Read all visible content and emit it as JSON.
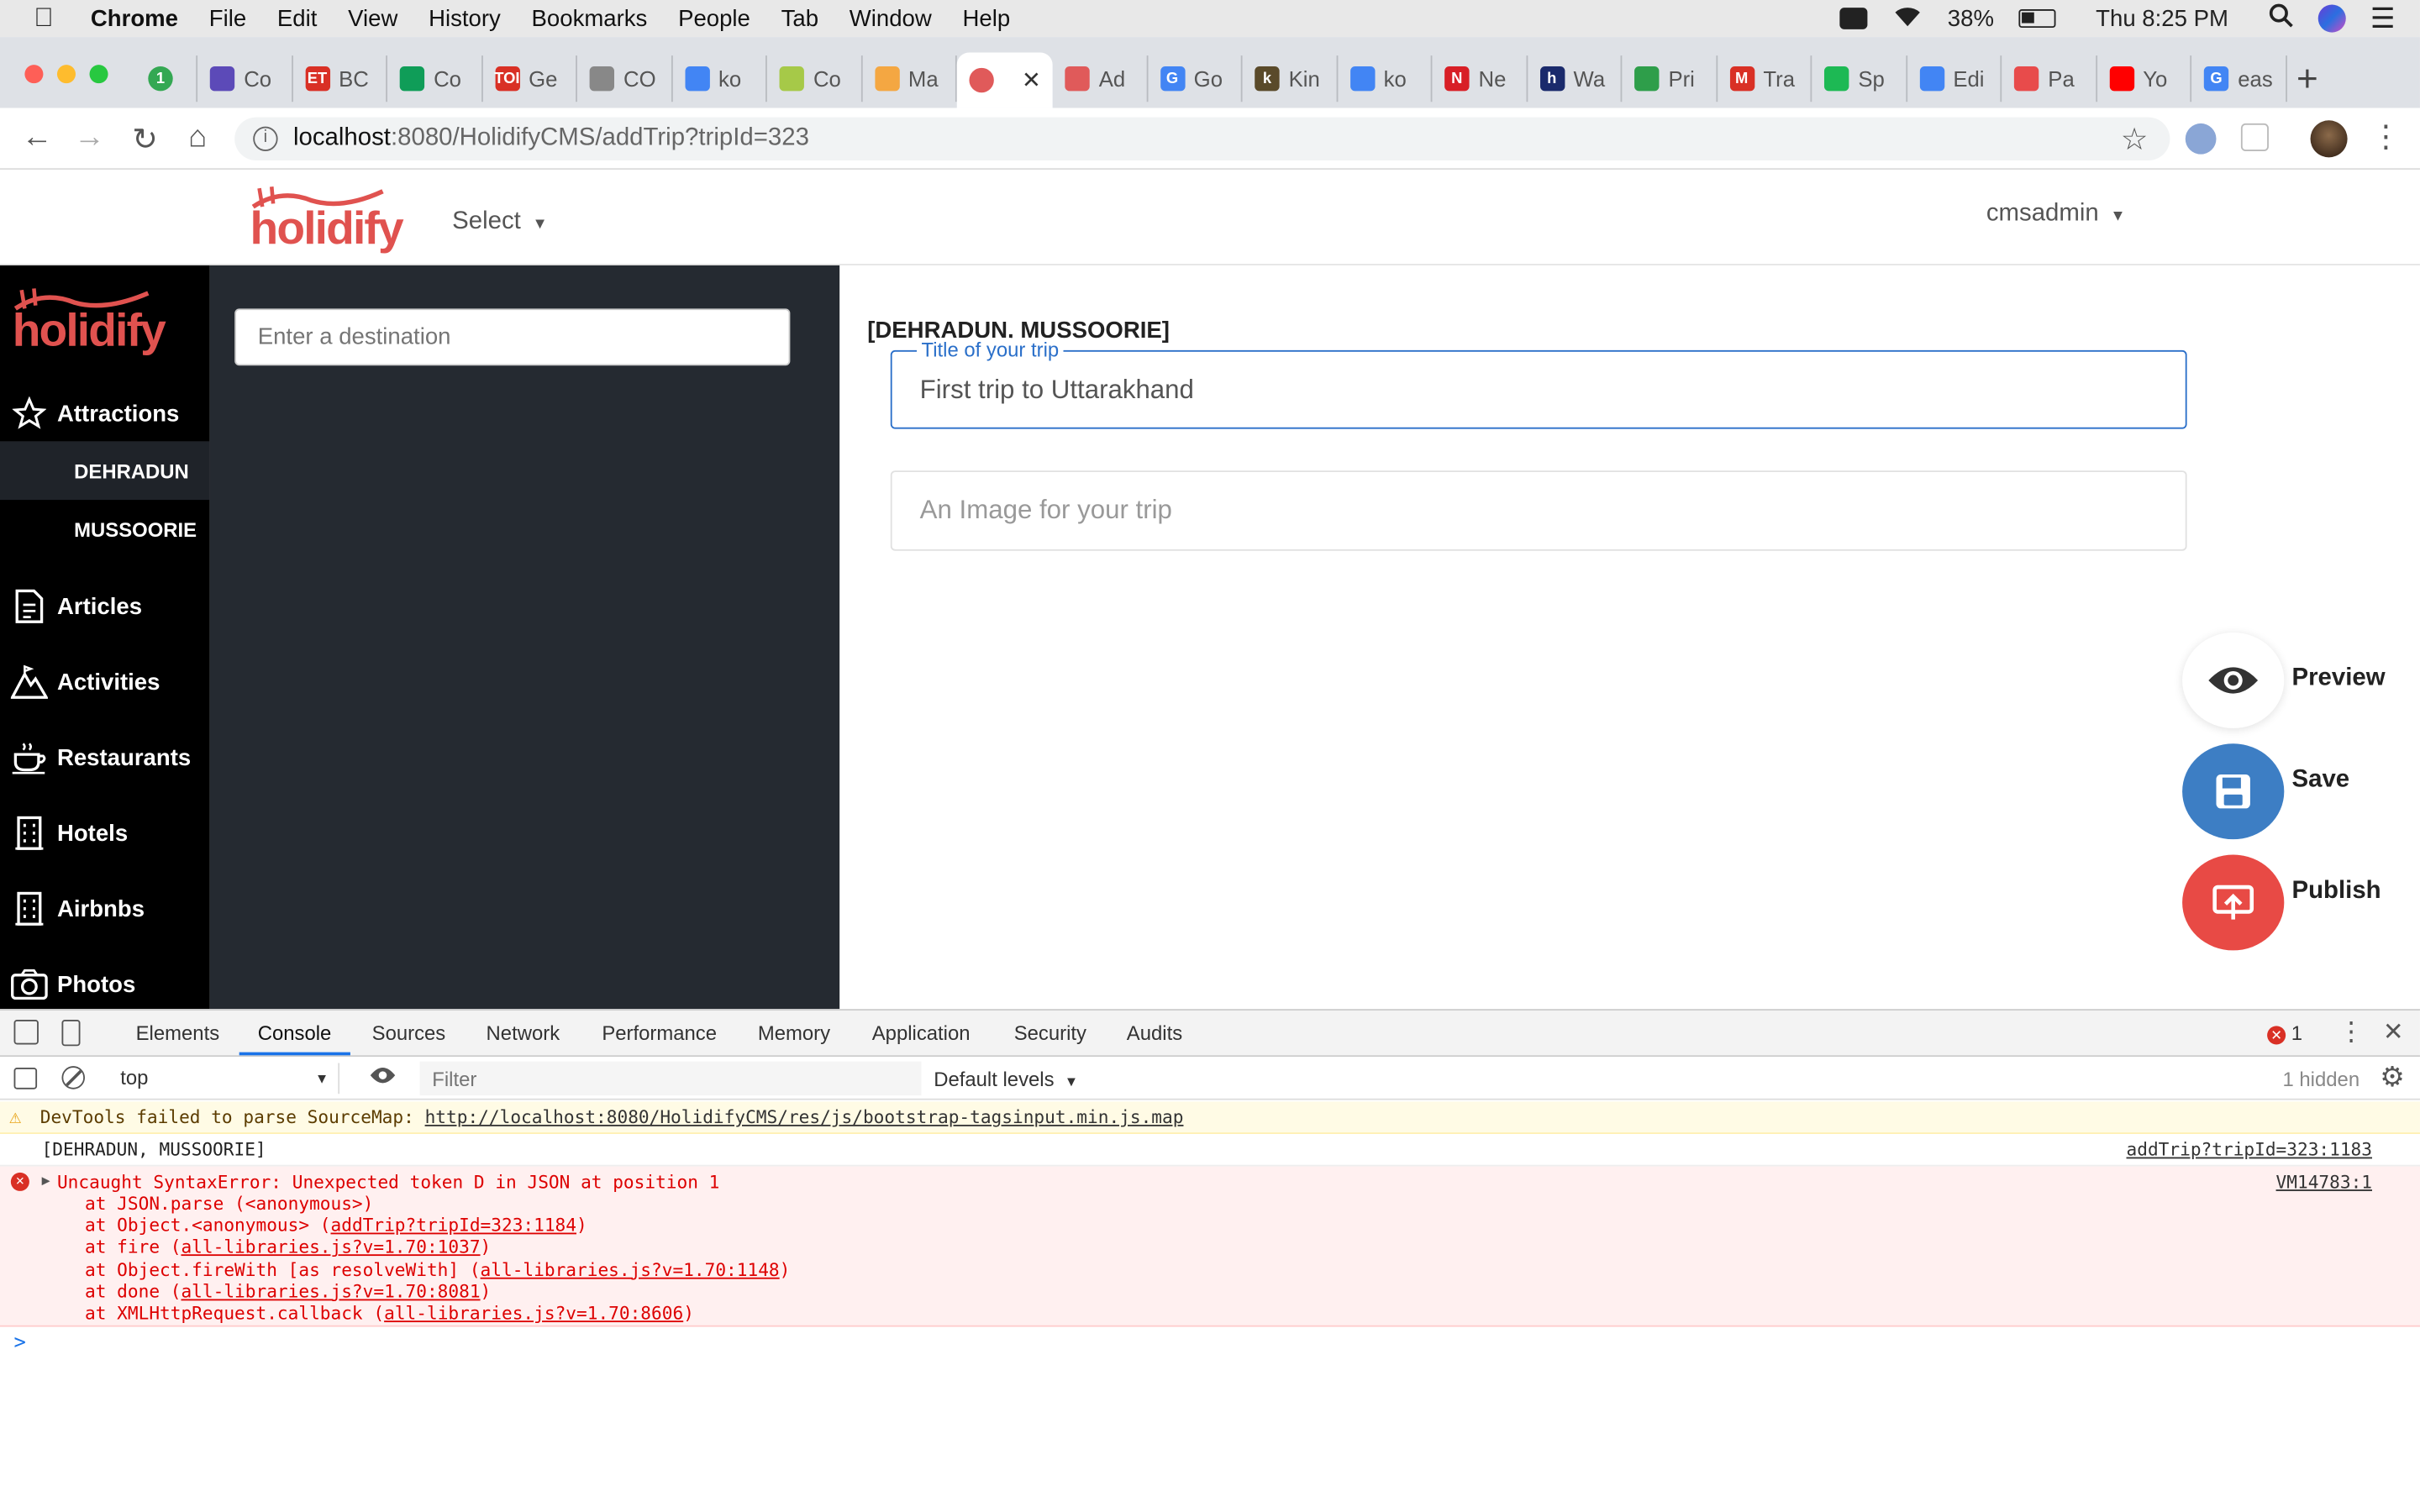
{
  "menubar": {
    "app": "Chrome",
    "items": [
      "File",
      "Edit",
      "View",
      "History",
      "Bookmarks",
      "People",
      "Tab",
      "Window",
      "Help"
    ],
    "battery": "38%",
    "clock": "Thu 8:25 PM"
  },
  "tabs": [
    {
      "label": "",
      "badge": "1",
      "color": "#34a853"
    },
    {
      "label": "Co",
      "color": "#5c4ab8"
    },
    {
      "label": "BC",
      "color": "#d93025",
      "fav": "ET"
    },
    {
      "label": "Co",
      "color": "#0f9d58"
    },
    {
      "label": "Ge",
      "color": "#d93025",
      "fav": "TOI"
    },
    {
      "label": "CO",
      "color": "#888888"
    },
    {
      "label": "ko",
      "color": "#4285f4"
    },
    {
      "label": "Co",
      "color": "#a6c948"
    },
    {
      "label": "Ma",
      "color": "#f4a742"
    },
    {
      "label": "",
      "color": "#e05a5a",
      "active": true
    },
    {
      "label": "Ad",
      "color": "#e05a5a"
    },
    {
      "label": "Go",
      "color": "#4285f4",
      "fav": "G"
    },
    {
      "label": "Kin",
      "color": "#5a4a2a",
      "fav": "k"
    },
    {
      "label": "ko",
      "color": "#4285f4"
    },
    {
      "label": "Ne",
      "color": "#d81f26",
      "fav": "N"
    },
    {
      "label": "Wa",
      "color": "#1a2a6c",
      "fav": "h"
    },
    {
      "label": "Pri",
      "color": "#2e9e4a"
    },
    {
      "label": "Tra",
      "color": "#d93025",
      "fav": "M"
    },
    {
      "label": "Sp",
      "color": "#1db954"
    },
    {
      "label": "Edi",
      "color": "#4285f4"
    },
    {
      "label": "Pa",
      "color": "#e84b4b"
    },
    {
      "label": "Yo",
      "color": "#ff0000"
    },
    {
      "label": "eas",
      "color": "#4285f4",
      "fav": "G"
    }
  ],
  "address": {
    "host": "localhost",
    "path": ":8080/HolidifyCMS/addTrip?tripId=323"
  },
  "header": {
    "logo": "holidify",
    "select_label": "Select",
    "user": "cmsadmin"
  },
  "sidebar": {
    "logo": "holidify",
    "items": [
      {
        "label": "Attractions",
        "icon": "star-icon"
      },
      {
        "label": "Articles",
        "icon": "document-icon"
      },
      {
        "label": "Activities",
        "icon": "mountain-icon"
      },
      {
        "label": "Restaurants",
        "icon": "coffee-icon"
      },
      {
        "label": "Hotels",
        "icon": "building-icon"
      },
      {
        "label": "Airbnbs",
        "icon": "building-icon"
      },
      {
        "label": "Photos",
        "icon": "camera-icon"
      }
    ],
    "subitems": [
      "DEHRADUN",
      "MUSSOORIE"
    ]
  },
  "destination": {
    "placeholder": "Enter a destination"
  },
  "trip": {
    "destinations_label": "[DEHRADUN, MUSSOORIE]",
    "title_legend": "Title of your trip",
    "title_value": "First trip to Uttarakhand",
    "image_placeholder": "An Image for your trip"
  },
  "actions": {
    "preview": "Preview",
    "save": "Save",
    "publish": "Publish"
  },
  "devtools": {
    "tabs": [
      "Elements",
      "Console",
      "Sources",
      "Network",
      "Performance",
      "Memory",
      "Application",
      "Security",
      "Audits"
    ],
    "active_tab": "Console",
    "error_count": "1",
    "context": "top",
    "filter_placeholder": "Filter",
    "levels": "Default levels",
    "hidden": "1 hidden",
    "warning": {
      "text": "DevTools failed to parse SourceMap:",
      "url": "http://localhost:8080/HolidifyCMS/res/js/bootstrap-tagsinput.min.js.map"
    },
    "log": {
      "text": "[DEHRADUN, MUSSOORIE]",
      "source": "addTrip?tripId=323:1183"
    },
    "error": {
      "message": "Uncaught SyntaxError: Unexpected token D in JSON at position 1",
      "source": "VM14783:1",
      "stack": [
        {
          "prefix": "at JSON.parse (<anonymous>)",
          "link": "",
          "suffix": ""
        },
        {
          "prefix": "at Object.<anonymous> (",
          "link": "addTrip?tripId=323:1184",
          "suffix": ")"
        },
        {
          "prefix": "at fire (",
          "link": "all-libraries.js?v=1.70:1037",
          "suffix": ")"
        },
        {
          "prefix": "at Object.fireWith [as resolveWith] (",
          "link": "all-libraries.js?v=1.70:1148",
          "suffix": ")"
        },
        {
          "prefix": "at done (",
          "link": "all-libraries.js?v=1.70:8081",
          "suffix": ")"
        },
        {
          "prefix": "at XMLHttpRequest.callback (",
          "link": "all-libraries.js?v=1.70:8606",
          "suffix": ")"
        }
      ]
    },
    "prompt": ">"
  },
  "colors": {
    "brand": "#e0524f",
    "save": "#3d7ec4",
    "publish": "#e84a45",
    "focus": "#2a6fc9"
  }
}
